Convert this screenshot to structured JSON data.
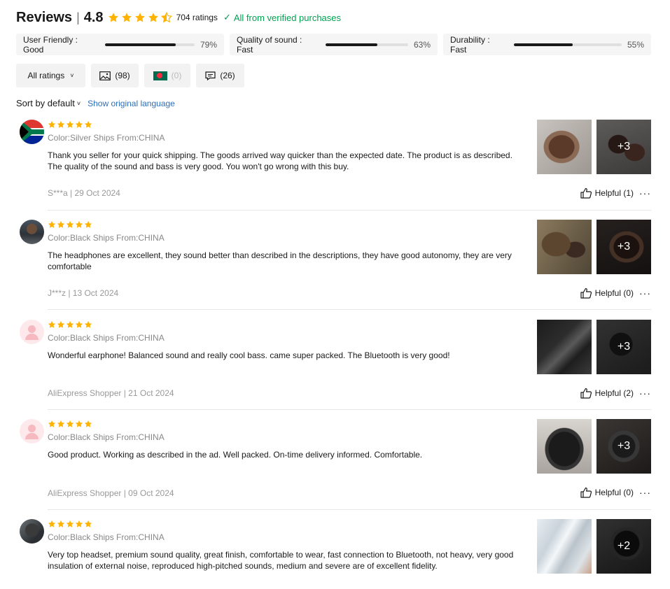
{
  "header": {
    "title": "Reviews",
    "separator": "|",
    "score": "4.8",
    "rating_value": 4.5,
    "ratings_count": "704 ratings",
    "verified": "All from verified purchases",
    "star_color": "#ffb300",
    "verified_color": "#00a250"
  },
  "metrics": [
    {
      "label": "User Friendly : Good",
      "percent": "79%",
      "value": 0.79
    },
    {
      "label": "Quality of sound : Fast",
      "percent": "63%",
      "value": 0.63
    },
    {
      "label": "Durability : Fast",
      "percent": "55%",
      "value": 0.55
    }
  ],
  "filters": {
    "all_ratings": "All ratings",
    "photos_count": "(98)",
    "country_count": "(0)",
    "comments_count": "(26)"
  },
  "sort": {
    "label": "Sort by default",
    "show_original": "Show original language"
  },
  "reviews": [
    {
      "stars": 5,
      "color_info": "Color:Silver Ships From:CHINA",
      "text": "Thank you seller for your quick shipping. The goods arrived way quicker than the expected date. The product is as described. The quality of the sound and bass is very good. You won't go wrong with this buy.",
      "author_date": "S***a | 29 Oct 2024",
      "helpful": "Helpful (1)",
      "more_photos": "+3"
    },
    {
      "stars": 5,
      "color_info": "Color:Black Ships From:CHINA",
      "text": "The headphones are excellent, they sound better than described in the descriptions, they have good autonomy, they are very comfortable",
      "author_date": "J***z | 13 Oct 2024",
      "helpful": "Helpful (0)",
      "more_photos": "+3"
    },
    {
      "stars": 5,
      "color_info": "Color:Black Ships From:CHINA",
      "text": "Wonderful earphone! Balanced sound and really cool bass. came super packed. The Bluetooth is very good!",
      "author_date": "AliExpress Shopper | 21 Oct 2024",
      "helpful": "Helpful (2)",
      "more_photos": "+3"
    },
    {
      "stars": 5,
      "color_info": "Color:Black Ships From:CHINA",
      "text": "Good product. Working as described in the ad. Well packed. On-time delivery informed. Comfortable.",
      "author_date": "AliExpress Shopper | 09 Oct 2024",
      "helpful": "Helpful (0)",
      "more_photos": "+3"
    },
    {
      "stars": 5,
      "color_info": "Color:Black Ships From:CHINA",
      "text": "Very top headset, premium sound quality, great finish, comfortable to wear, fast connection to Bluetooth, not heavy, very good insulation of external noise, reproduced high-pitched sounds, medium and severe are of excellent fidelity.",
      "author_date": "",
      "helpful": "",
      "more_photos": "+2"
    }
  ]
}
